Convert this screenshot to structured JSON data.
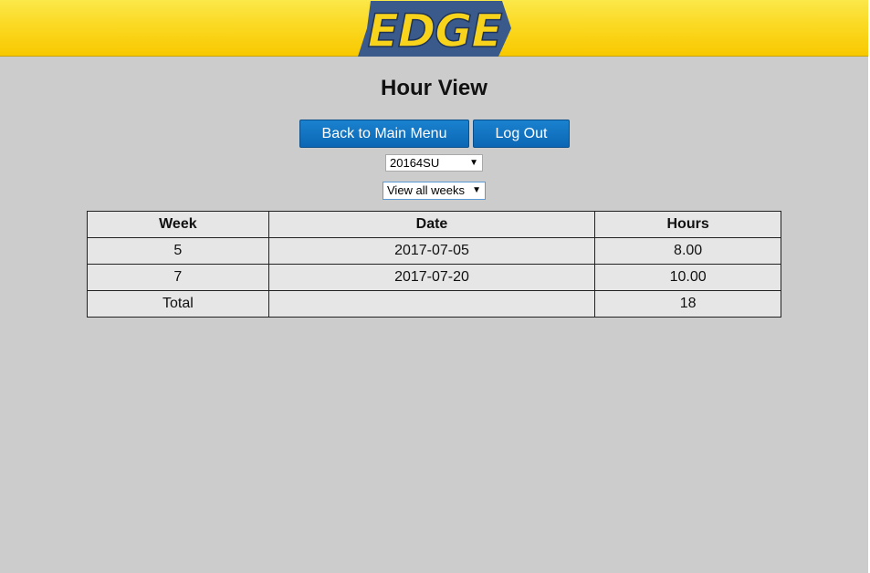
{
  "header": {
    "logo_text": "EDGE",
    "colors": {
      "bar": "#fbd923",
      "logo_blue": "#3a5a8c",
      "logo_yellow": "#f7d31c"
    }
  },
  "page": {
    "title": "Hour View"
  },
  "buttons": {
    "main_menu": "Back to Main Menu",
    "logout": "Log Out"
  },
  "filters": {
    "term": {
      "selected": "20164SU",
      "icon": "dropdown-arrow-icon"
    },
    "week": {
      "selected": "View all weeks",
      "icon": "dropdown-arrow-icon"
    }
  },
  "table": {
    "headers": [
      "Week",
      "Date",
      "Hours"
    ],
    "rows": [
      [
        "5",
        "2017-07-05",
        "8.00"
      ],
      [
        "7",
        "2017-07-20",
        "10.00"
      ],
      [
        "Total",
        "",
        "18"
      ]
    ]
  }
}
